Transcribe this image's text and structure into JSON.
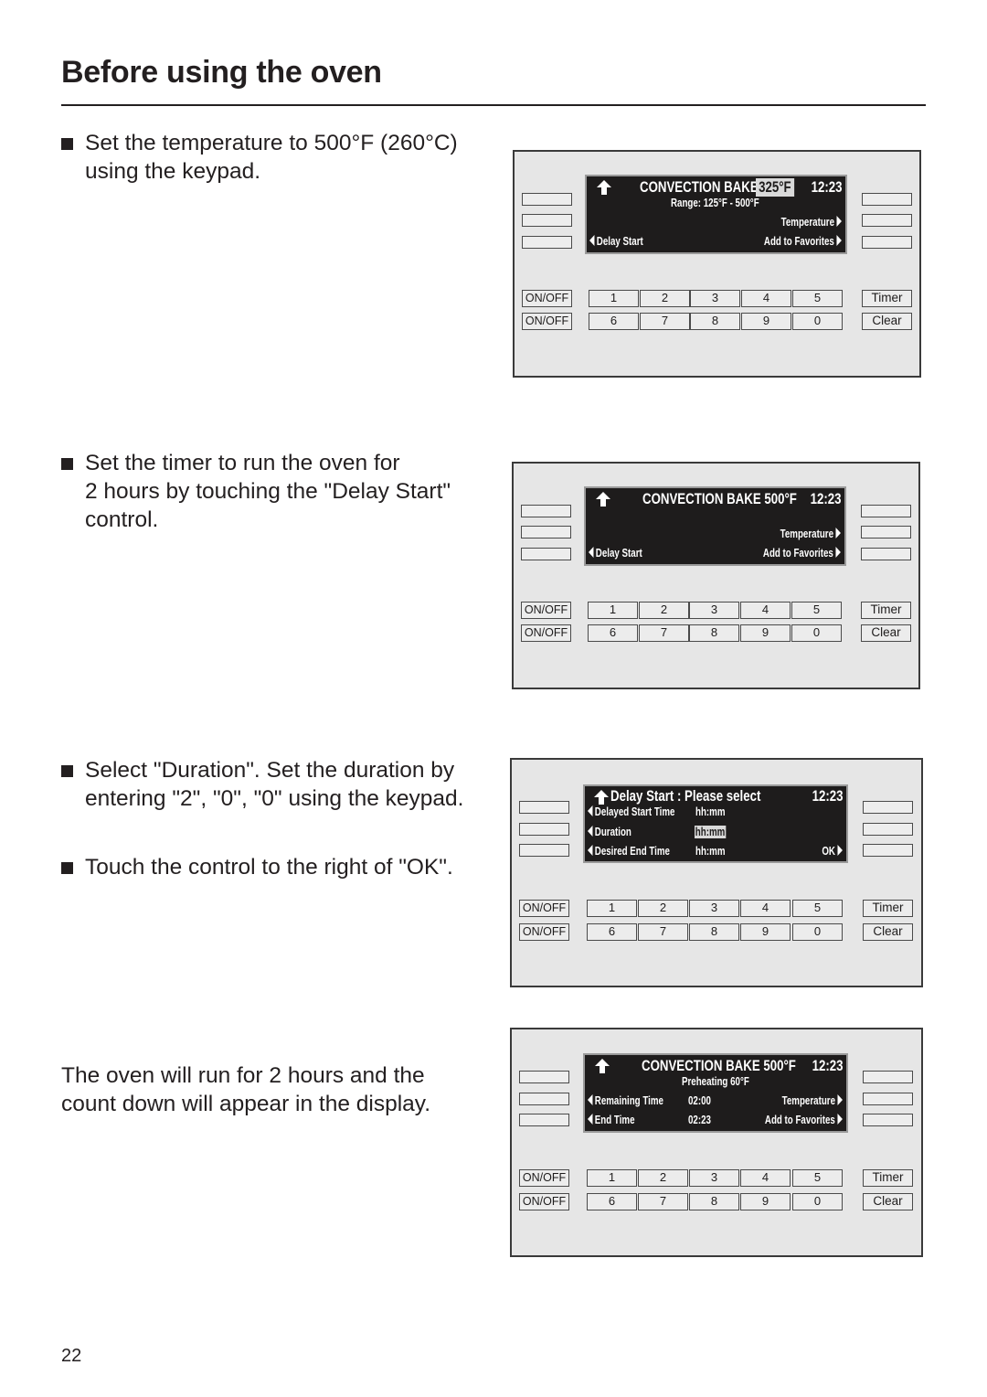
{
  "page": {
    "title": "Before using the oven",
    "page_number": "22"
  },
  "steps": [
    {
      "lines": [
        "Set the temperature to 500°F (260°C)",
        "using the keypad."
      ],
      "bullet": true
    },
    {
      "lines": [
        "Set the timer to run the oven for",
        "2 hours by touching the \"Delay Start\"",
        "control."
      ],
      "bullet": true
    },
    {
      "lines": [
        "Select \"Duration\". Set the duration by",
        "entering \"2\", \"0\", \"0\" using the keypad."
      ],
      "bullet": true
    },
    {
      "lines": [
        "Touch the control to the right of \"OK\"."
      ],
      "bullet": true
    },
    {
      "lines": [
        "The oven will run for 2 hours and the",
        "count down will appear in the display."
      ],
      "bullet": false
    }
  ],
  "keypad": {
    "on_off": "ON/OFF",
    "row1": [
      "1",
      "2",
      "3",
      "4",
      "5"
    ],
    "row2": [
      "6",
      "7",
      "8",
      "9",
      "0"
    ],
    "timer": "Timer",
    "clear": "Clear"
  },
  "panels": [
    {
      "mode": "CONVECTION BAKE",
      "temp": "325°F",
      "clock": "12:23",
      "subtitle": "Range: 125°F - 500°F",
      "right_1": "Temperature",
      "left_2": "Delay Start",
      "right_2": "Add to Favorites"
    },
    {
      "mode_temp": "CONVECTION BAKE 500°F",
      "clock": "12:23",
      "right_1": "Temperature",
      "left_2": "Delay Start",
      "right_2": "Add to Favorites"
    },
    {
      "heading": "Delay Start : Please select",
      "clock": "12:23",
      "rows": [
        {
          "label": "Delayed Start Time",
          "value": "hh:mm"
        },
        {
          "label": "Duration",
          "value": "hh:mm"
        },
        {
          "label": "Desired End Time",
          "value": "hh:mm",
          "right": "OK"
        }
      ]
    },
    {
      "mode_temp": "CONVECTION BAKE 500°F",
      "clock": "12:23",
      "subtitle": "Preheating 60°F",
      "left_1": "Remaining Time",
      "value_1": "02:00",
      "right_1": "Temperature",
      "left_2": "End Time",
      "value_2": "02:23",
      "right_2": "Add to Favorites"
    }
  ]
}
